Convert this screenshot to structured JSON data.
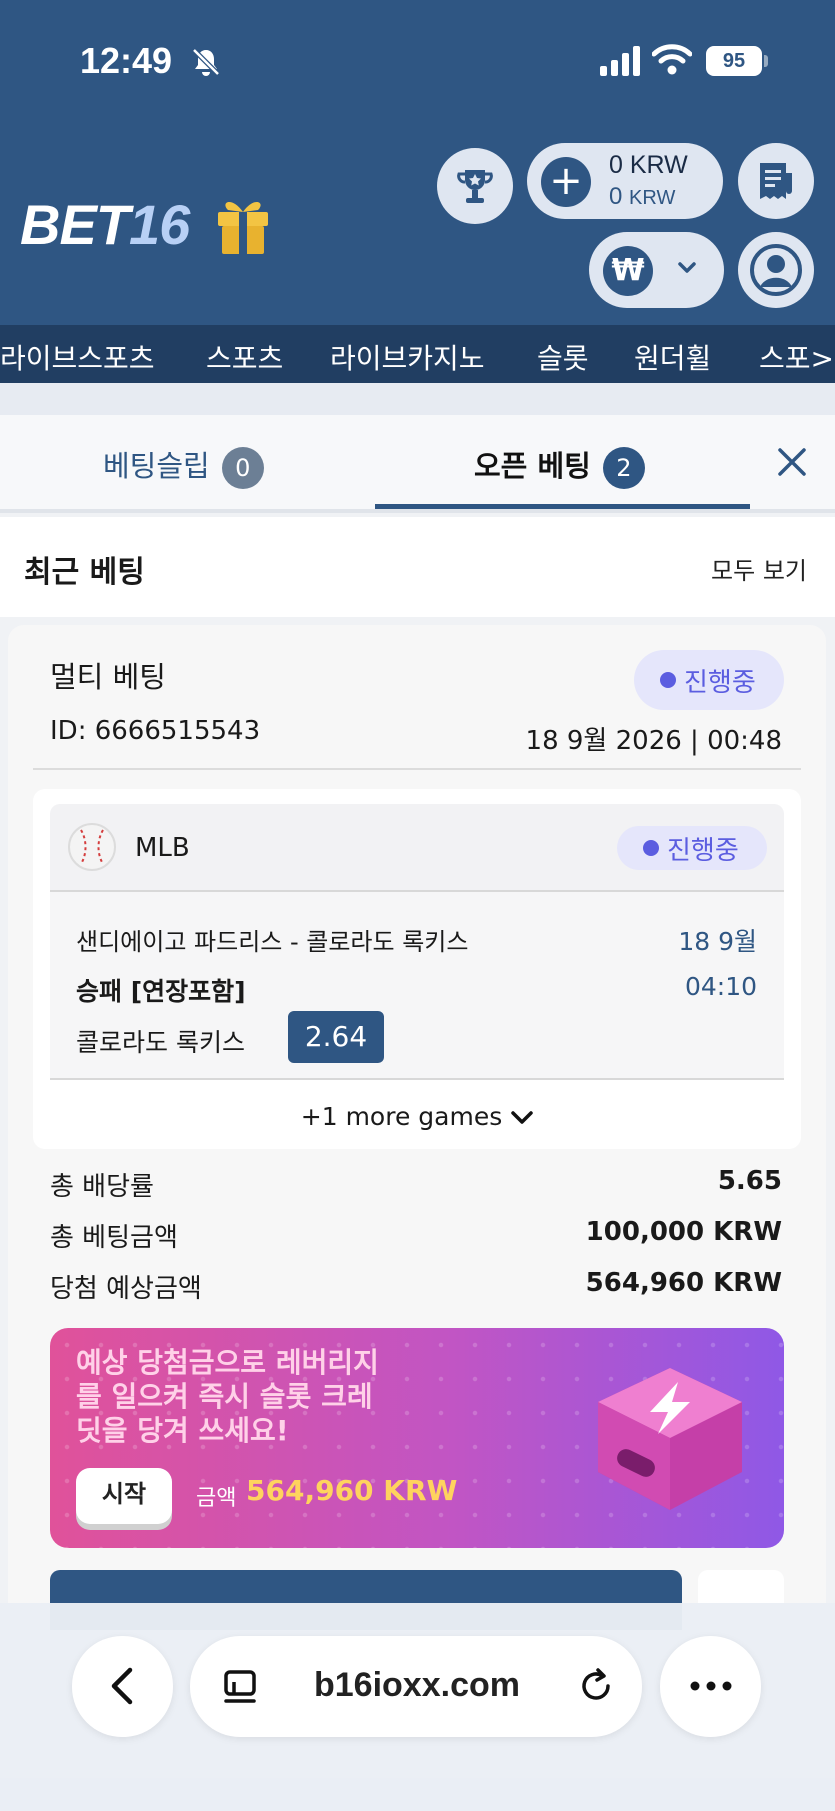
{
  "status_bar": {
    "time": "12:49",
    "battery": "95"
  },
  "header": {
    "logo_text": "BET",
    "logo_number": "16",
    "balance_main": "0 KRW",
    "balance_sub_value": "0",
    "balance_sub_unit": "KRW",
    "currency_symbol": "₩"
  },
  "nav": {
    "items": [
      "라이브스포츠",
      "스포츠",
      "라이브카지노",
      "슬롯",
      "원더휠",
      "스포>"
    ]
  },
  "tabs": {
    "betslip": {
      "label": "베팅슬립",
      "count": "0"
    },
    "open_bets": {
      "label": "오픈 베팅",
      "count": "2"
    }
  },
  "recent": {
    "title": "최근 베팅",
    "view_all": "모두 보기"
  },
  "bet": {
    "type": "멀티 베팅",
    "status": "진행중",
    "id": "ID: 6666515543",
    "datetime": "18 9월 2026 | 00:48",
    "game": {
      "league": "MLB",
      "status": "진행중",
      "match": "샌디에이고 파드리스 - 콜로라도 록키스",
      "date": "18 9월",
      "market": "승패 [연장포함]",
      "time": "04:10",
      "selection": "콜로라도 록키스",
      "odds": "2.64"
    },
    "more_games": "+1 more games",
    "summary": [
      {
        "label": "총 배당률",
        "value": "5.65"
      },
      {
        "label": "총 베팅금액",
        "value": "100,000 KRW"
      },
      {
        "label": "당첨 예상금액",
        "value": "564,960 KRW"
      }
    ]
  },
  "promo": {
    "line1": "예상 당첨금으로 레버리지",
    "line2": "를 일으켜 즉시 슬롯 크레",
    "line3": "딧을 당겨 쓰세요!",
    "button": "시작",
    "amount_label": "금액",
    "amount": "564,960 KRW"
  },
  "browser": {
    "url": "b16ioxx.com"
  },
  "colors": {
    "header": "#2f5683",
    "nav": "#213e62",
    "accent": "#2f5683",
    "status_pill": "#5b5de0",
    "promo_amount": "#ffd35e"
  },
  "icons": [
    "bell-slash-icon",
    "signal-icon",
    "wifi-icon",
    "gift-icon",
    "trophy-icon",
    "plus-icon",
    "receipt-icon",
    "won-icon",
    "chevron-down-icon",
    "user-icon",
    "close-icon",
    "baseball-icon",
    "lightning-cube-icon",
    "chevron-left-icon",
    "tabs-icon",
    "reload-icon",
    "more-icon"
  ]
}
